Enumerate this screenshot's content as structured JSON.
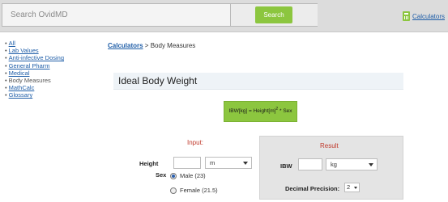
{
  "search": {
    "placeholder": "Search OvidMD",
    "button_label": "Search"
  },
  "header": {
    "calculators_link": "Calculators"
  },
  "sidebar": {
    "items": [
      {
        "label": "All",
        "link": true
      },
      {
        "label": "Lab Values",
        "link": true
      },
      {
        "label": "Anti-infective Dosing",
        "link": true
      },
      {
        "label": "General Pharm",
        "link": true
      },
      {
        "label": "Medical",
        "link": true
      },
      {
        "label": "Body Measures",
        "link": false
      },
      {
        "label": "MathCalc",
        "link": true
      },
      {
        "label": "Glossary",
        "link": true
      }
    ]
  },
  "breadcrumb": {
    "root": "Calculators",
    "separator": " > ",
    "current": "Body Measures"
  },
  "page": {
    "title": "Ideal Body Weight"
  },
  "formula": {
    "prefix": "IBW[kg] = Height[m]",
    "exponent": "2",
    "suffix": " * Sex"
  },
  "input": {
    "heading": "Input:",
    "height_label": "Height",
    "height_value": "",
    "height_unit": "m",
    "sex_label": "Sex",
    "sex_options": [
      {
        "label": "Male (23)",
        "checked": true
      },
      {
        "label": "Female (21.5)",
        "checked": false
      }
    ]
  },
  "result": {
    "heading": "Result",
    "ibw_label": "IBW",
    "ibw_value": "",
    "ibw_unit": "kg",
    "precision_label": "Decimal Precision:",
    "precision_value": "2"
  },
  "colors": {
    "accent_green": "#8cc63f",
    "link_blue": "#1f5ea8",
    "heading_red": "#c0392b",
    "result_panel_bg": "#e4e4e4"
  }
}
